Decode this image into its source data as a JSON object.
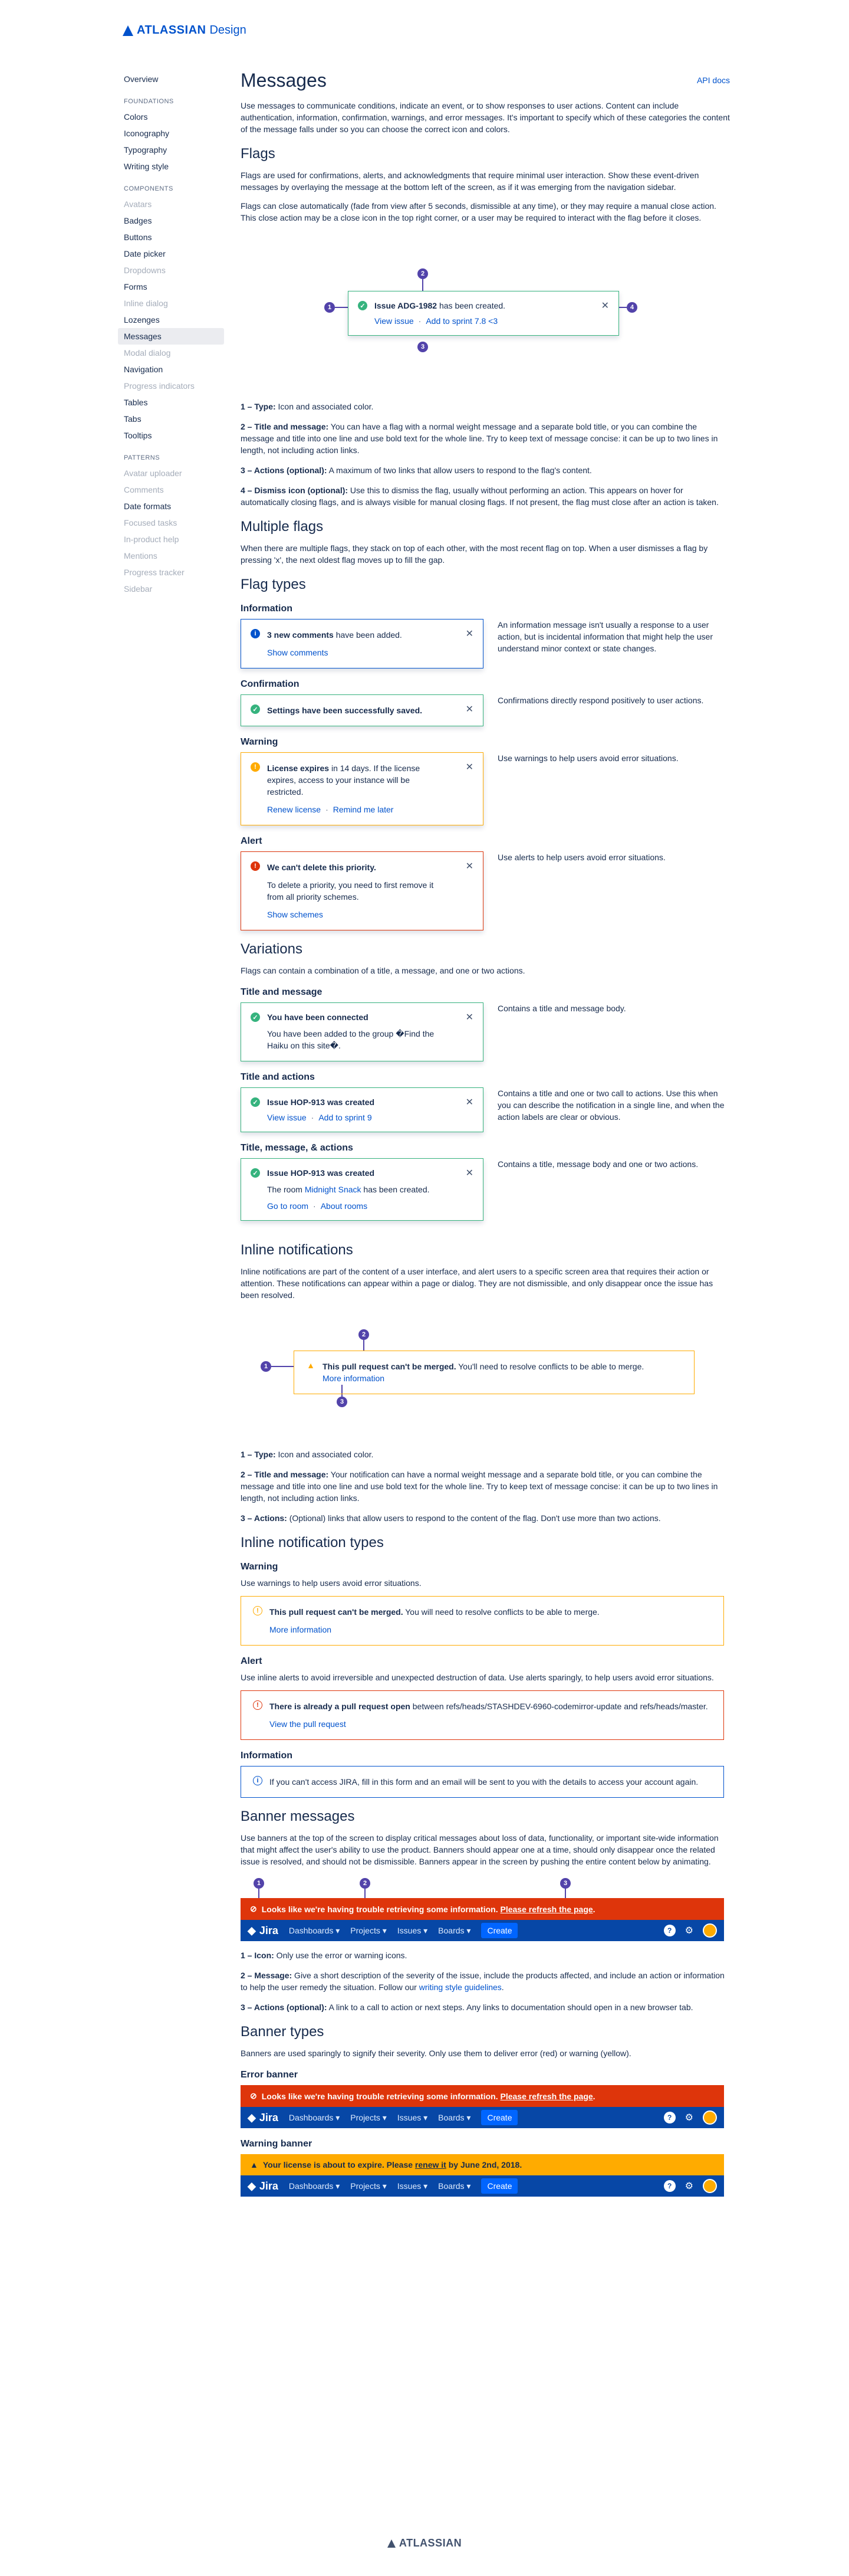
{
  "logo": {
    "brand": "ATLASSIAN",
    "sub": "Design"
  },
  "sidebar": {
    "overview": "Overview",
    "sections": [
      {
        "title": "FOUNDATIONS",
        "items": [
          {
            "label": "Colors",
            "state": "normal"
          },
          {
            "label": "Iconography",
            "state": "normal"
          },
          {
            "label": "Typography",
            "state": "normal"
          },
          {
            "label": "Writing style",
            "state": "normal"
          }
        ]
      },
      {
        "title": "COMPONENTS",
        "items": [
          {
            "label": "Avatars",
            "state": "dis"
          },
          {
            "label": "Badges",
            "state": "normal"
          },
          {
            "label": "Buttons",
            "state": "normal"
          },
          {
            "label": "Date picker",
            "state": "normal"
          },
          {
            "label": "Dropdowns",
            "state": "dis"
          },
          {
            "label": "Forms",
            "state": "normal"
          },
          {
            "label": "Inline dialog",
            "state": "dis"
          },
          {
            "label": "Lozenges",
            "state": "normal"
          },
          {
            "label": "Messages",
            "state": "act"
          },
          {
            "label": "Modal dialog",
            "state": "dis"
          },
          {
            "label": "Navigation",
            "state": "normal"
          },
          {
            "label": "Progress indicators",
            "state": "dis"
          },
          {
            "label": "Tables",
            "state": "normal"
          },
          {
            "label": "Tabs",
            "state": "normal"
          },
          {
            "label": "Tooltips",
            "state": "normal"
          }
        ]
      },
      {
        "title": "PATTERNS",
        "items": [
          {
            "label": "Avatar uploader",
            "state": "dis"
          },
          {
            "label": "Comments",
            "state": "dis"
          },
          {
            "label": "Date formats",
            "state": "normal"
          },
          {
            "label": "Focused tasks",
            "state": "dis"
          },
          {
            "label": "In-product help",
            "state": "dis"
          },
          {
            "label": "Mentions",
            "state": "dis"
          },
          {
            "label": "Progress tracker",
            "state": "dis"
          },
          {
            "label": "Sidebar",
            "state": "dis"
          }
        ]
      }
    ]
  },
  "main": {
    "title": "Messages",
    "api_docs": "API docs",
    "intro": "Use messages to communicate conditions, indicate an event, or to show responses to user actions. Content can include authentication, information, confirmation, warnings, and error messages. It's important to specify which of these categories the content of the message falls under so you can choose the correct icon and colors.",
    "flags_title": "Flags",
    "flags_p1": "Flags are used for confirmations, alerts, and acknowledgments that require minimal user interaction. Show these event-driven messages by overlaying the message at the bottom left of the screen, as if it was emerging from the navigation sidebar.",
    "flags_p2": "Flags can close automatically (fade from view after 5 seconds, dismissible at any time), or they may require a manual close action. This close action may be a close icon in the top right corner, or a user may be required to interact with the flag before it closes.",
    "diagram_flag": {
      "title_bold": "Issue ADG-1982",
      "title_rest": " has been created.",
      "action1": "View issue",
      "action2": "Add to sprint 7.8 <3"
    },
    "flag_notes": [
      {
        "bold": "1 – Type:",
        "text": " Icon and associated color."
      },
      {
        "bold": "2 – Title and message:",
        "text": " You can have a flag with a normal weight message and a separate bold title, or you can combine the message and title into one line and use bold text for the whole line. Try to keep text of message concise: it can be up to two lines in length, not including action links."
      },
      {
        "bold": "3 – Actions (optional):",
        "text": " A maximum of two links that allow users to respond to the flag's content."
      },
      {
        "bold": "4 – Dismiss icon (optional):",
        "text": " Use this to dismiss the flag, usually without performing an action. This appears on hover for automatically closing flags, and is always visible for manual closing flags. If not present, the flag must close after an action is taken."
      }
    ],
    "multiple_title": "Multiple flags",
    "multiple_p": "When there are multiple flags, they stack on top of each other, with the most recent flag on top. When a user dismisses a flag by pressing 'x', the next oldest flag moves up to fill the gap.",
    "types_title": "Flag types",
    "types": [
      {
        "label": "Information",
        "color": "#0052CC",
        "icon": "i",
        "title_bold": "3 new comments",
        "title_rest": " have been added.",
        "body": "",
        "actions": [
          "Show comments"
        ],
        "desc": "An information message isn't usually a response to a user action, but is incidental information that might help the user understand minor context or state changes."
      },
      {
        "label": "Confirmation",
        "color": "#36B37E",
        "icon": "✓",
        "title_bold": "Settings have been successfully saved.",
        "title_rest": "",
        "body": "",
        "actions": [],
        "desc": "Confirmations directly respond positively to user actions."
      },
      {
        "label": "Warning",
        "color": "#FFAB00",
        "icon": "!",
        "title_bold": "License expires",
        "title_rest": " in 14 days. If the license expires, access to your instance will be restricted.",
        "body": "",
        "actions": [
          "Renew license",
          "Remind me later"
        ],
        "desc": "Use warnings to help users avoid error situations."
      },
      {
        "label": "Alert",
        "color": "#DE350B",
        "icon": "!",
        "title_bold": "We can't delete this priority.",
        "title_rest": "",
        "body": "To delete a priority, you need to first remove it from all priority schemes.",
        "actions": [
          "Show schemes"
        ],
        "desc": "Use alerts to help users avoid error situations."
      }
    ],
    "variations_title": "Variations",
    "variations_p": "Flags can contain a combination of a title, a message, and one or two actions.",
    "variations": [
      {
        "label": "Title and message",
        "title_bold": "You have been connected",
        "body_prefix": "You have been added to the group �Find the Haiku on this site�.",
        "body_link": "",
        "body_suffix": "",
        "actions": [],
        "desc": "Contains a title and message body."
      },
      {
        "label": "Title and actions",
        "title_bold": "Issue HOP-913 was created",
        "body_prefix": "",
        "body_link": "",
        "body_suffix": "",
        "actions": [
          "View issue",
          "Add to sprint 9"
        ],
        "desc": "Contains a title and one or two call to actions. Use this when you can describe the notification in a single line, and when the action labels are clear or obvious."
      },
      {
        "label": "Title, message, & actions",
        "title_bold": "Issue HOP-913 was created",
        "body_prefix": "The room ",
        "body_link": "Midnight Snack",
        "body_suffix": " has been created.",
        "actions": [
          "Go to room",
          "About rooms"
        ],
        "desc": "Contains a title, message body and one or two actions."
      }
    ],
    "inline_title": "Inline notifications",
    "inline_p": "Inline notifications are part of the content of a user interface, and alert users to a specific screen area that requires their action or attention. These notifications can appear within a page or dialog. They are not dismissible, and only disappear once the issue has been resolved.",
    "inline_diagram": {
      "bold": "This pull request can't be merged.",
      "rest": " You'll need to resolve conflicts to be able to merge.",
      "action": "More information"
    },
    "inline_notes": [
      {
        "bold": "1 – Type:",
        "text": " Icon and associated color."
      },
      {
        "bold": "2 – Title and message:",
        "text": " Your notification can have a normal weight message and a separate bold title, or you can combine the message and title into one line and use bold text for the whole line. Try to keep text of message concise: it can be up to two lines in length, not including action links."
      },
      {
        "bold": "3 – Actions:",
        "text": " (Optional) links that allow users to respond to the content of the flag. Don't use more than two actions."
      }
    ],
    "inline_types_title": "Inline notification types",
    "inline_types": [
      {
        "label": "Warning",
        "desc": "Use warnings to help users avoid error situations.",
        "border": "#FFAB00",
        "bg": "#fff",
        "icon": "!",
        "icolor": "#FFAB00",
        "bold": "This pull request can't be merged.",
        "rest": " You will need to resolve conflicts to be able to merge.",
        "action": "More information"
      },
      {
        "label": "Alert",
        "desc": "Use inline alerts to avoid irreversible and unexpected destruction of data. Use alerts sparingly, to help users avoid error situations.",
        "border": "#DE350B",
        "bg": "#fff",
        "icon": "!",
        "icolor": "#DE350B",
        "bold": "There is already a pull request open",
        "rest": " between refs/heads/STASHDEV-6960-codemirror-update and refs/heads/master.",
        "action": "View the pull request"
      },
      {
        "label": "Information",
        "desc": "",
        "border": "#0052CC",
        "bg": "#fff",
        "icon": "i",
        "icolor": "#0052CC",
        "bold": "",
        "rest": "If you can't access JIRA, fill in this form and an email will be sent to you with the details to access your account again.",
        "action": ""
      }
    ],
    "banner_title": "Banner messages",
    "banner_p": "Use banners at the top of the screen to display critical messages about loss of data, functionality, or important site-wide information that might affect the user's ability to use the product. Banners should appear one at a time, should only disappear once the related issue is resolved, and should not be dismissible. Banners appear in the screen by pushing the entire content below by animating.",
    "banner_error": {
      "text": "Looks like we're having trouble retrieving some information. ",
      "link": "Please refresh the page",
      "end": "."
    },
    "banner_warning": {
      "text_a": "Your license is about to expire. Please ",
      "link": "renew it",
      "text_b": " by June 2nd, 2018."
    },
    "jira_nav": {
      "product": "Jira",
      "items": [
        "Dashboards ▾",
        "Projects ▾",
        "Issues ▾",
        "Boards ▾"
      ],
      "create": "Create",
      "help": "?",
      "settings": "⚙"
    },
    "banner_notes": [
      {
        "bold": "1 – Icon:",
        "text": " Only use the error or warning icons."
      },
      {
        "bold": "2 – Message:",
        "text": " Give a short description of the severity of the issue, include the products affected, and include an action or information to help the user remedy the situation. Follow our ",
        "link": "writing style guidelines",
        "end": "."
      },
      {
        "bold": "3 – Actions (optional):",
        "text": " A link to a call to action or next steps. Any links to documentation should open in a new browser tab."
      }
    ],
    "banner_types_title": "Banner types",
    "banner_types_p": "Banners are used sparingly to signify their severity. Only use them to deliver error (red) or warning (yellow).",
    "error_banner_label": "Error banner",
    "warning_banner_label": "Warning banner"
  },
  "footer": {
    "brand": "ATLASSIAN"
  },
  "colors": {
    "primary": "#0052CC",
    "success": "#36B37E",
    "warning": "#FFAB00",
    "error": "#DE350B",
    "nav": "#0747A6",
    "annotation": "#5243AA"
  }
}
